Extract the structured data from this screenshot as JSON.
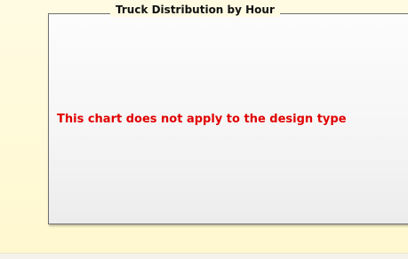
{
  "chart_panel": {
    "title": "Truck Distribution by Hour",
    "message": "This chart does not apply to the design type"
  }
}
